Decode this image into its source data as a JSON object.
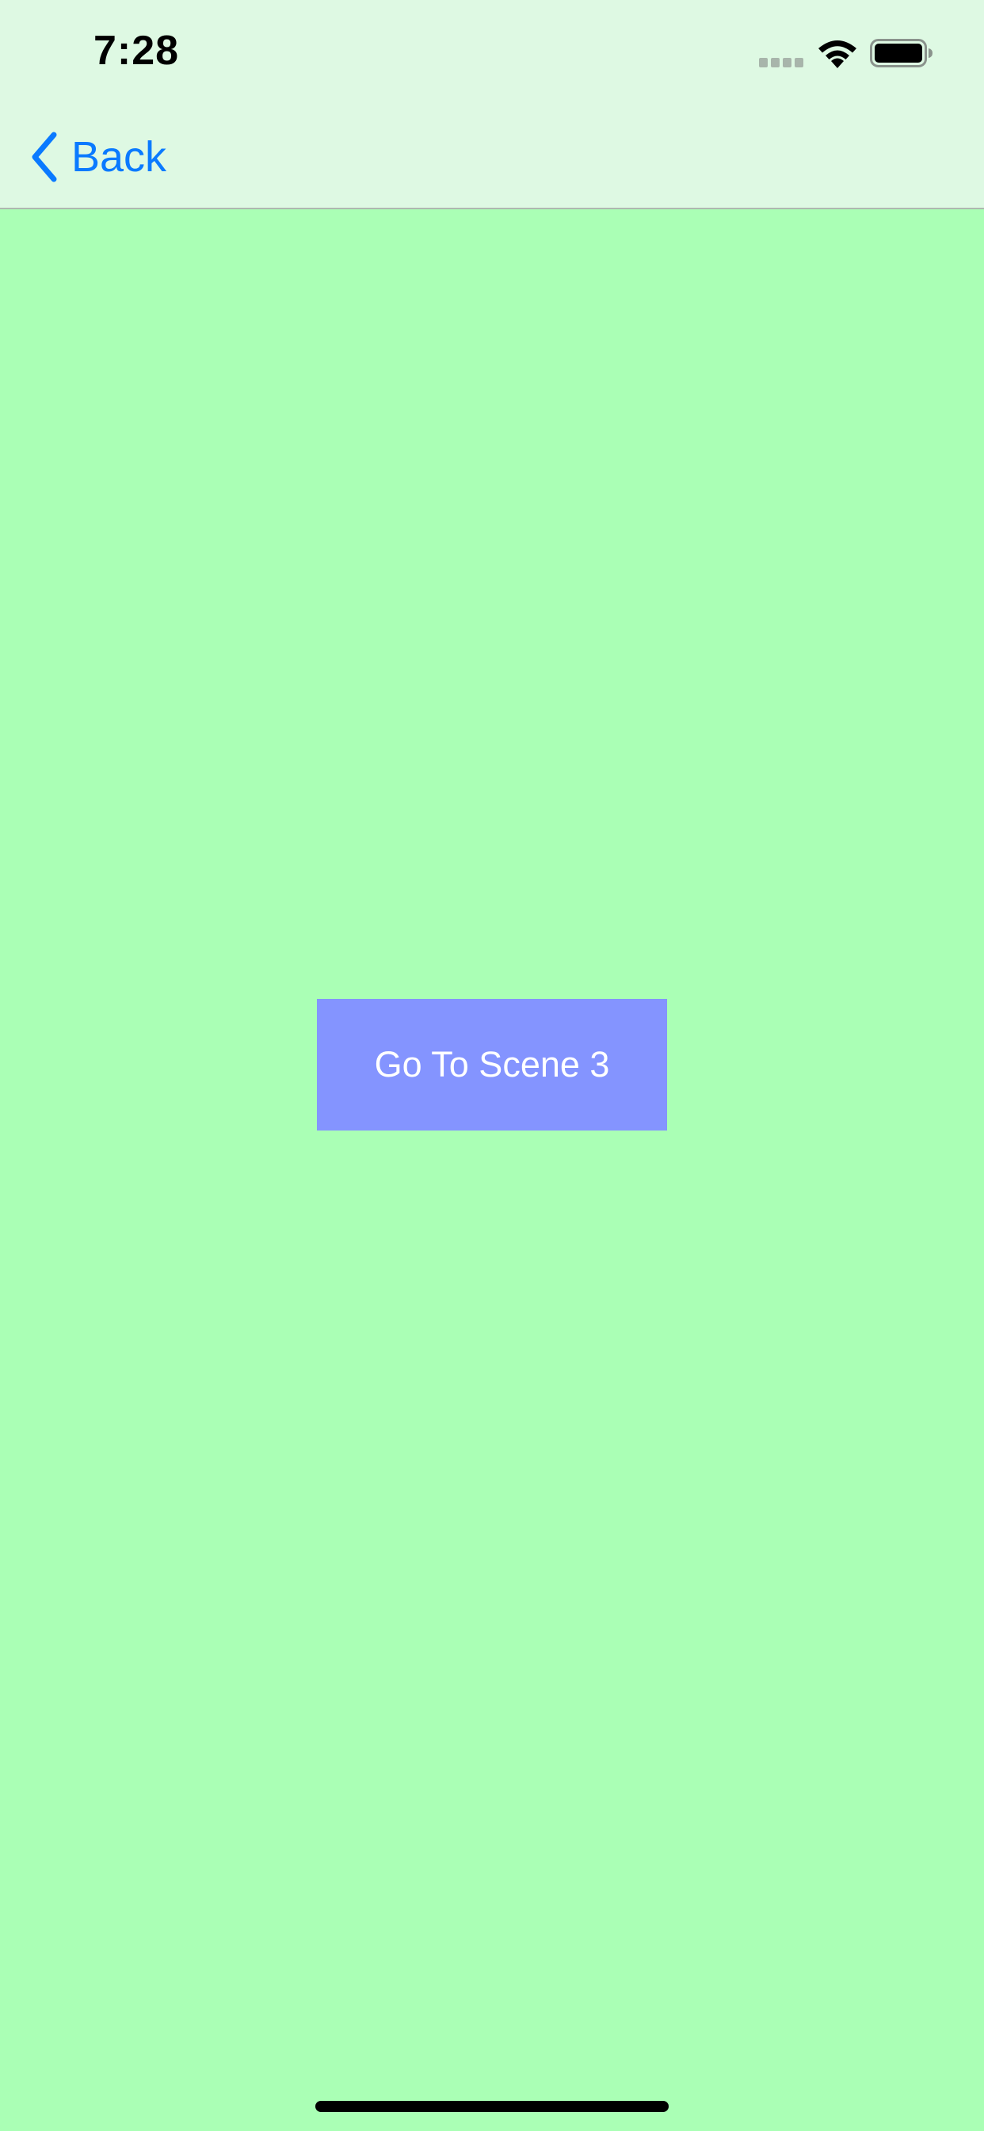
{
  "status_bar": {
    "time": "7:28",
    "signal_icon": "cellular-signal-icon",
    "wifi_icon": "wifi-icon",
    "battery_icon": "battery-icon"
  },
  "nav_bar": {
    "back_label": "Back",
    "back_icon": "chevron-left-icon"
  },
  "main": {
    "scene_button_label": "Go To Scene 3"
  },
  "colors": {
    "background": "#AAFFB5",
    "nav_background": "#DEF9E3",
    "accent": "#0A7AFF",
    "button_background": "#8494FF",
    "button_text": "#FFFFFF"
  }
}
